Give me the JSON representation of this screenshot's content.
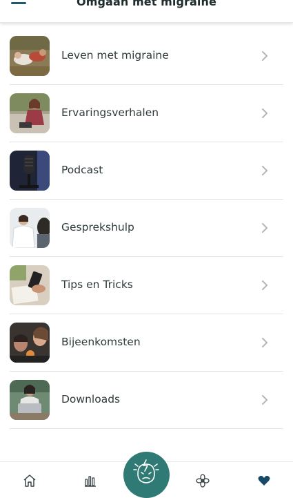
{
  "header": {
    "title": "Omgaan met migraine",
    "menu_icon": "hamburger-menu-icon"
  },
  "colors": {
    "accent": "#1e5a6e",
    "tab_accent": "#2f7a74",
    "divider": "#e3e3e3",
    "chevron": "#b5b5b5"
  },
  "menu": {
    "items": [
      {
        "label": "Leven met migraine",
        "thumb": "people-lying-in-grass-photo"
      },
      {
        "label": "Ervaringsverhalen",
        "thumb": "woman-tying-shoe-photo"
      },
      {
        "label": "Podcast",
        "thumb": "microphone-photo"
      },
      {
        "label": "Gesprekshulp",
        "thumb": "doctor-consultation-photo"
      },
      {
        "label": "Tips en Tricks",
        "thumb": "phone-and-notebook-photo"
      },
      {
        "label": "Bijeenkomsten",
        "thumb": "group-gathering-photo"
      },
      {
        "label": "Downloads",
        "thumb": "woman-with-laptop-photo"
      }
    ]
  },
  "tabbar": {
    "items": [
      "home-icon",
      "statistics-icon",
      "migraine-head-icon",
      "flower-icon",
      "heart-icon"
    ],
    "active": "heart-icon"
  }
}
